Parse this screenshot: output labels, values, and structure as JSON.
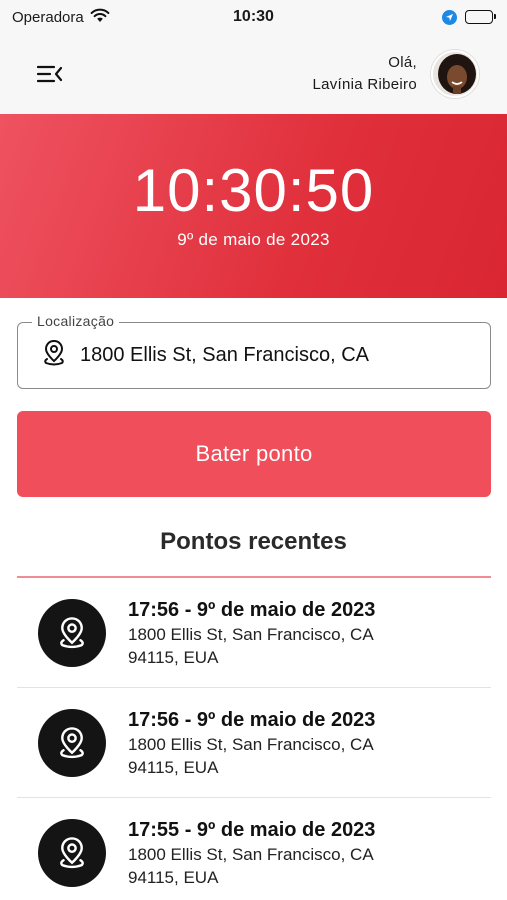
{
  "status_bar": {
    "carrier": "Operadora",
    "time": "10:30"
  },
  "header": {
    "greeting": "Olá,",
    "user_name": "Lavínia Ribeiro"
  },
  "clock": {
    "time": "10:30:50",
    "date": "9º de maio de 2023"
  },
  "location": {
    "label": "Localização",
    "value": "1800 Ellis St, San Francisco, CA"
  },
  "punch_button": {
    "label": "Bater ponto"
  },
  "recent": {
    "title": "Pontos recentes",
    "items": [
      {
        "time": "17:56 - 9º de maio de 2023",
        "address": "1800 Ellis St, San Francisco, CA 94115, EUA"
      },
      {
        "time": "17:56 - 9º de maio de 2023",
        "address": "1800 Ellis St, San Francisco, CA 94115, EUA"
      },
      {
        "time": "17:55 - 9º de maio de 2023",
        "address": "1800 Ellis St, San Francisco, CA 94115, EUA"
      }
    ]
  },
  "icons": {
    "wifi": "wifi-icon",
    "location_services": "location-arrow-icon",
    "battery": "battery-icon",
    "menu": "menu-collapse-icon",
    "location_pin": "location-pin-icon"
  },
  "colors": {
    "hero_start": "#ef5260",
    "hero_end": "#d92632",
    "button": "#f04e5a",
    "divider": "#f08c92",
    "pin_circle": "#141414"
  }
}
